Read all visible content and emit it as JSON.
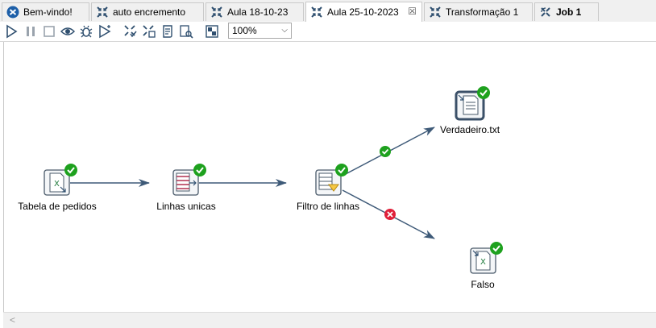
{
  "tabs": [
    {
      "label": "Bem-vindo!",
      "icon": "spoon-logo-icon",
      "active": false
    },
    {
      "label": "auto encremento",
      "icon": "transformation-icon",
      "active": false
    },
    {
      "label": "Aula 18-10-23",
      "icon": "transformation-icon",
      "active": false
    },
    {
      "label": "Aula 25-10-2023",
      "icon": "transformation-icon",
      "active": true,
      "close": "☒"
    },
    {
      "label": "Transformação 1",
      "icon": "transformation-icon",
      "active": false
    },
    {
      "label": "Job 1",
      "icon": "job-icon",
      "active": false
    }
  ],
  "toolbar": {
    "zoom_value": "100%",
    "icons": [
      "run-icon",
      "pause-icon",
      "stop-icon",
      "preview-icon",
      "debug-icon",
      "replay-icon",
      "verify-icon",
      "impact-icon",
      "sql-icon",
      "explore-db-icon",
      "show-results-icon"
    ]
  },
  "steps": {
    "tabela": {
      "label": "Tabela de pedidos",
      "icon": "excel-input-icon",
      "status": "ok"
    },
    "linhas": {
      "label": "Linhas unicas",
      "icon": "unique-rows-icon",
      "status": "ok"
    },
    "filtro": {
      "label": "Filtro de linhas",
      "icon": "filter-rows-icon",
      "status": "ok"
    },
    "verdadeiro": {
      "label": "Verdadeiro.txt",
      "icon": "text-output-icon",
      "status": "ok"
    },
    "falso": {
      "label": "Falso",
      "icon": "excel-output-icon",
      "status": "ok"
    }
  },
  "hops": [
    {
      "from": "tabela",
      "to": "linhas",
      "type": "normal"
    },
    {
      "from": "linhas",
      "to": "filtro",
      "type": "normal"
    },
    {
      "from": "filtro",
      "to": "verdadeiro",
      "type": "true"
    },
    {
      "from": "filtro",
      "to": "falso",
      "type": "false"
    }
  ],
  "colors": {
    "hop": "#3e5a78",
    "ok": "#1ea11e",
    "error": "#e0203a",
    "step_border": "#4a5a6a"
  },
  "scrollbar": {
    "left_arrow": "<"
  }
}
